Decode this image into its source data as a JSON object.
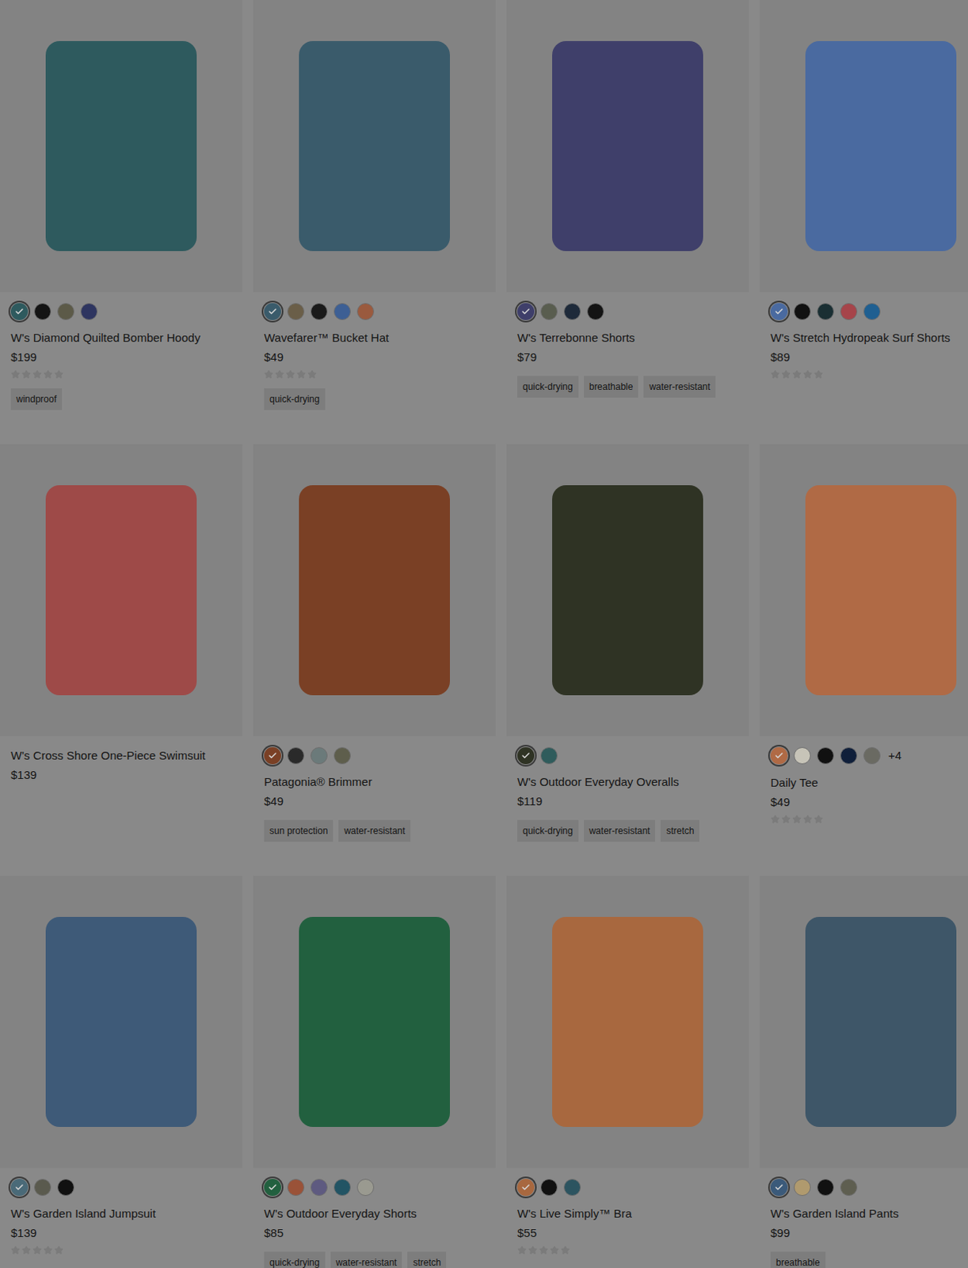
{
  "products": [
    {
      "name": "W's Diamond Quilted Bomber Hoody",
      "price": "$199",
      "stars": 0,
      "color": "#2e5a5e",
      "more": "",
      "tags": [
        "windproof"
      ],
      "swatches": [
        {
          "color": "#2e5a5e",
          "selected": true
        },
        {
          "color": "#141414",
          "selected": false
        },
        {
          "color": "#5c5a48",
          "selected": false
        },
        {
          "color": "#2e3560",
          "selected": false
        }
      ]
    },
    {
      "name": "Wavefarer™ Bucket Hat",
      "price": "$49",
      "stars": 0,
      "color": "#3a5b6b",
      "more": "",
      "tags": [
        "quick-drying"
      ],
      "swatches": [
        {
          "color": "#3a5b6b",
          "selected": true
        },
        {
          "color": "#6a5e48",
          "selected": false
        },
        {
          "color": "#1a1a1a",
          "selected": false
        },
        {
          "color": "#3d5f94",
          "selected": false
        },
        {
          "color": "#9a5a3e",
          "selected": false
        }
      ]
    },
    {
      "name": "W's Terrebonne Shorts",
      "price": "$79",
      "color": "#3f3f6a",
      "more": "",
      "tags": [
        "quick-drying",
        "breathable",
        "water-resistant"
      ],
      "swatches": [
        {
          "color": "#3f3f6a",
          "selected": true
        },
        {
          "color": "#595d4f",
          "selected": false
        },
        {
          "color": "#1e2a3a",
          "selected": false
        },
        {
          "color": "#141414",
          "selected": false
        }
      ]
    },
    {
      "name": "W's Stretch Hydropeak Surf Shorts",
      "price": "$89",
      "stars": 0,
      "color": "#4a6aa0",
      "more": "",
      "tags": [],
      "swatches": [
        {
          "color": "#4a6aa0",
          "selected": true
        },
        {
          "color": "#111111",
          "selected": false
        },
        {
          "color": "#1a2f33",
          "selected": false
        },
        {
          "color": "#a6444a",
          "selected": false
        },
        {
          "color": "#1f5f91",
          "selected": false
        }
      ]
    },
    {
      "name": "W's Cross Shore One-Piece Swimsuit",
      "price": "$139",
      "color": "#9e4a48",
      "more": "",
      "tags": [],
      "swatches": []
    },
    {
      "name": "Patagonia® Brimmer",
      "price": "$49",
      "color": "#7a4025",
      "more": "",
      "tags": [
        "sun protection",
        "water-resistant"
      ],
      "swatches": [
        {
          "color": "#7a4025",
          "selected": true
        },
        {
          "color": "#2a2a2a",
          "selected": false
        },
        {
          "color": "#6b7a7a",
          "selected": false
        },
        {
          "color": "#5e5e4c",
          "selected": false
        }
      ]
    },
    {
      "name": "W's Outdoor Everyday Overalls",
      "price": "$119",
      "color": "#2f3324",
      "more": "",
      "tags": [
        "quick-drying",
        "water-resistant",
        "stretch"
      ],
      "swatches": [
        {
          "color": "#2f3324",
          "selected": true
        },
        {
          "color": "#2f5c5c",
          "selected": false
        }
      ]
    },
    {
      "name": "Daily Tee",
      "price": "$49",
      "stars": 0,
      "color": "#b06a45",
      "more": "+4",
      "tags": [],
      "swatches": [
        {
          "color": "#b06a45",
          "selected": true
        },
        {
          "color": "#c7c4b8",
          "selected": false
        },
        {
          "color": "#111111",
          "selected": false
        },
        {
          "color": "#0f1f3a",
          "selected": false
        },
        {
          "color": "#6a6a62",
          "selected": false
        }
      ]
    },
    {
      "name": "W's Garden Island Jumpsuit",
      "price": "$139",
      "stars": 0,
      "color": "#3e5a78",
      "more": "",
      "tags": [],
      "swatches": [
        {
          "color": "#4a6a78",
          "selected": true
        },
        {
          "color": "#5a5a4e",
          "selected": false
        },
        {
          "color": "#111111",
          "selected": false
        }
      ]
    },
    {
      "name": "W's Outdoor Everyday Shorts",
      "price": "$85",
      "color": "#22603f",
      "more": "",
      "tags": [
        "quick-drying",
        "water-resistant",
        "stretch"
      ],
      "swatches": [
        {
          "color": "#22603f",
          "selected": true
        },
        {
          "color": "#9a5238",
          "selected": false
        },
        {
          "color": "#5e5a80",
          "selected": false
        },
        {
          "color": "#225464",
          "selected": false
        },
        {
          "color": "#9a9a90",
          "selected": false
        }
      ]
    },
    {
      "name": "W's Live Simply™ Bra",
      "price": "$55",
      "stars": 0,
      "color": "#a8683f",
      "more": "",
      "tags": [],
      "swatches": [
        {
          "color": "#a8683f",
          "selected": true
        },
        {
          "color": "#111111",
          "selected": false
        },
        {
          "color": "#2c5460",
          "selected": false
        }
      ]
    },
    {
      "name": "W's Garden Island Pants",
      "price": "$99",
      "color": "#3e5668",
      "more": "",
      "tags": [
        "breathable"
      ],
      "swatches": [
        {
          "color": "#3b5a7a",
          "selected": true
        },
        {
          "color": "#b09a6e",
          "selected": false
        },
        {
          "color": "#111111",
          "selected": false
        },
        {
          "color": "#5e5e50",
          "selected": false
        }
      ]
    }
  ]
}
